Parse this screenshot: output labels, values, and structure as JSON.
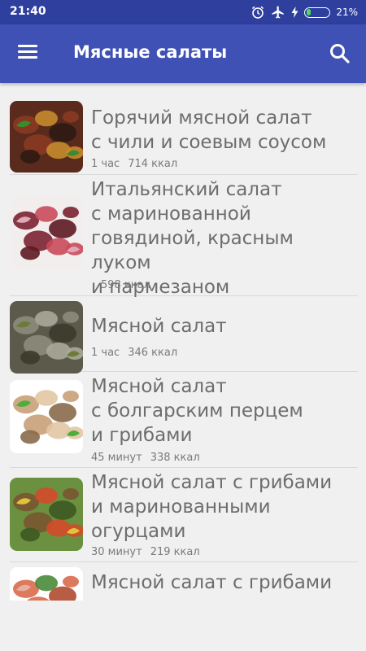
{
  "status_bar": {
    "time": "21:40",
    "battery_percent": "21%",
    "battery_level": 0.21
  },
  "app_bar": {
    "title": "Мясные салаты",
    "menu_icon": "menu-icon",
    "search_icon": "search-icon"
  },
  "recipes": [
    {
      "title_lines": [
        "Горячий мясной салат",
        "с чили и соевым соусом"
      ],
      "time": "1 час",
      "calories": "714 ккал"
    },
    {
      "title_lines": [
        "Итальянский салат",
        "с маринованной",
        "говядиной, красным луком",
        "и пармезаном"
      ],
      "time": "",
      "calories": "598 ккал"
    },
    {
      "title_lines": [
        "Мясной салат"
      ],
      "time": "1 час",
      "calories": "346 ккал"
    },
    {
      "title_lines": [
        "Мясной салат",
        "с болгарским перцем",
        "и грибами"
      ],
      "time": "45 минут",
      "calories": "338 ккал"
    },
    {
      "title_lines": [
        "Мясной салат с грибами",
        "и маринованными",
        "огурцами"
      ],
      "time": "30 минут",
      "calories": "219 ккал"
    },
    {
      "title_lines": [
        "Мясной салат с грибами"
      ],
      "time": "",
      "calories": ""
    }
  ]
}
